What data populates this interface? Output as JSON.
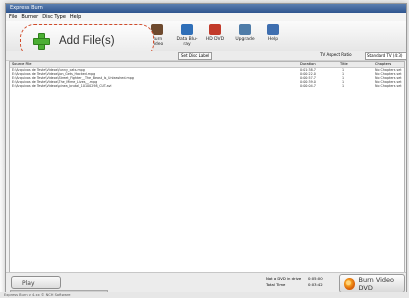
{
  "window": {
    "title": "Express Burn"
  },
  "menu": [
    "File",
    "Burner",
    "Disc Type",
    "Help"
  ],
  "toolbar": [
    {
      "label": "Burn Video",
      "icon": "clapboard-icon",
      "color": "#6e4a2e"
    },
    {
      "label": "Data Blu-ray",
      "icon": "blu-ray-icon",
      "color": "#2f6fb8"
    },
    {
      "label": "HD DVD",
      "icon": "hd-dvd-icon",
      "color": "#c23a2a"
    },
    {
      "label": "Upgrade",
      "icon": "upgrade-icon",
      "color": "#4f7ca8"
    },
    {
      "label": "Help",
      "icon": "help-icon",
      "color": "#3f6fb0"
    }
  ],
  "add_files": {
    "label": "Add File(s)"
  },
  "options": {
    "set_disc_label": "Set Disc Label",
    "tv_aspect_ratio_label": "TV Aspect Ratio",
    "tv_aspect_ratio_value": "Standard TV (4:3)"
  },
  "table": {
    "headers": [
      "Source File",
      "Duration",
      "Title",
      "Chapters"
    ],
    "rows": [
      {
        "file": "E:\\Arquivos de Teste\\Videos\\funny_cats.mpg",
        "duration": "0:01:38.7",
        "title": "1",
        "chapters": "No Chapters set"
      },
      {
        "file": "E:\\Arquivos de Teste\\Videos\\Jon_Gets_Hacked.mpg",
        "duration": "0:00:22.0",
        "title": "1",
        "chapters": "No Chapters set"
      },
      {
        "file": "E:\\Arquivos de Teste\\Videos\\Street_Fighter__The_Beast_Is_Unleashed.mpg",
        "duration": "0:00:57.7",
        "title": "1",
        "chapters": "No Chapters set"
      },
      {
        "file": "E:\\Arquivos de Teste\\Videos\\The_Mime_Lives__.mpg",
        "duration": "0:00:39.0",
        "title": "1",
        "chapters": "No Chapters set"
      },
      {
        "file": "E:\\Arquivos de Teste\\Videos\\pinea_brutal_10100298_CUT.avi",
        "duration": "0:00:04.7",
        "title": "1",
        "chapters": "No Chapters set"
      }
    ]
  },
  "footer": {
    "play_label": "Play",
    "fit_label": "Not a DVD in drive",
    "fit_value": "0:05:00",
    "total_label": "Total Time",
    "total_value": "0:03:42",
    "burn_label": "Burn Video DVD"
  },
  "status": "Express Burn v 4.xx © NCH Software"
}
